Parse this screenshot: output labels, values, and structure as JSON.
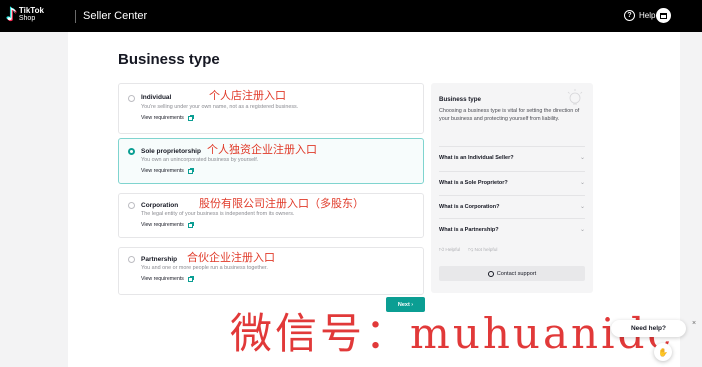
{
  "header": {
    "logo_line1": "TikTok",
    "logo_line2": "Shop",
    "app_title": "Seller Center",
    "help_label": "Help"
  },
  "page_title": "Business type",
  "options": [
    {
      "name": "Individual",
      "annotation": "个人店注册入口",
      "description": "You're selling under your own name, not as a registered business.",
      "link": "View requirements",
      "selected": false
    },
    {
      "name": "Sole proprietorship",
      "annotation": "个人独资企业注册入口",
      "description": "You own an unincorporated business by yourself.",
      "link": "View requirements",
      "selected": true
    },
    {
      "name": "Corporation",
      "annotation": "股份有限公司注册入口（多股东）",
      "description": "The legal entity of your business is independent from its owners.",
      "link": "View requirements",
      "selected": false
    },
    {
      "name": "Partnership",
      "annotation": "合伙企业注册入口",
      "description": "You and one or more people run a business together.",
      "link": "View requirements",
      "selected": false
    }
  ],
  "next_label": "Next  ›",
  "side": {
    "title": "Business type",
    "description": "Choosing a business type is vital for setting the direction of your business and protecting yourself from liability.",
    "faqs": [
      "What is an Individual Seller?",
      "What is a Sole Proprietor?",
      "What is a Corporation?",
      "What is a Partnership?"
    ],
    "helpful": "Helpful",
    "not_helpful": "Not helpful",
    "contact_label": "Contact support"
  },
  "watermark": "微信号：muhuanidc",
  "need_help_label": "Need help?",
  "accent_color": "#0b9e93"
}
